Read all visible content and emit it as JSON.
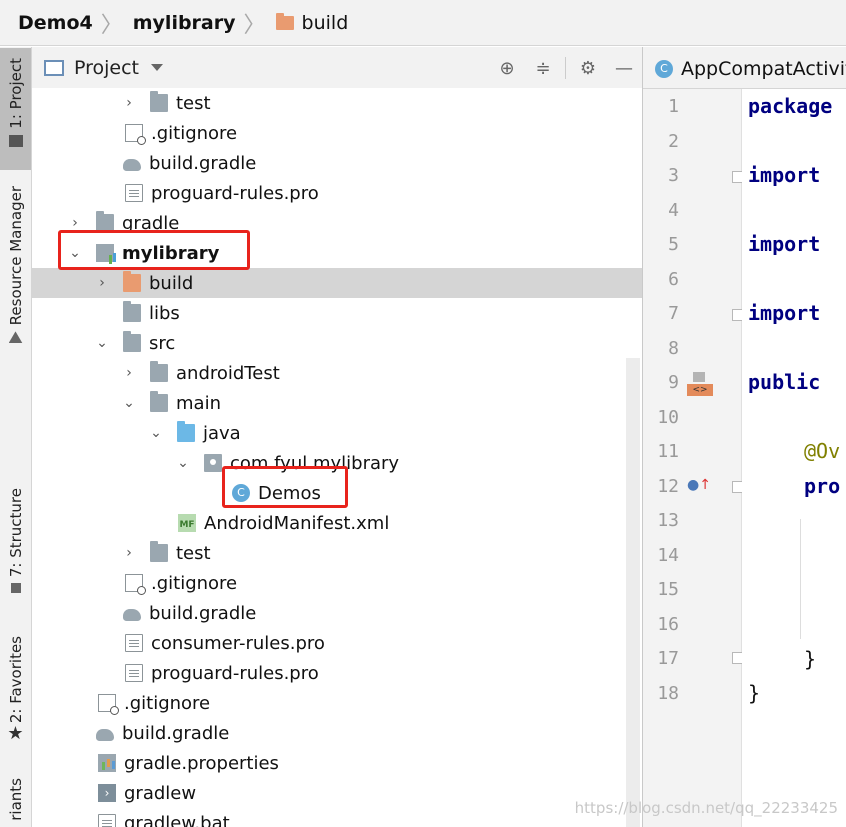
{
  "breadcrumb": [
    "Demo4",
    "mylibrary",
    "build"
  ],
  "left_strip": {
    "project_tab": "1: Project",
    "resource_manager_tab": "Resource Manager",
    "structure_tab": "7: Structure",
    "favorites_tab": "2: Favorites",
    "variants_tab": "riants"
  },
  "project_panel": {
    "title": "Project"
  },
  "tree": [
    {
      "label": "test"
    },
    {
      "label": ".gitignore"
    },
    {
      "label": "build.gradle"
    },
    {
      "label": "proguard-rules.pro"
    },
    {
      "label": "gradle"
    },
    {
      "label": "mylibrary"
    },
    {
      "label": "build"
    },
    {
      "label": "libs"
    },
    {
      "label": "src"
    },
    {
      "label": "androidTest"
    },
    {
      "label": "main"
    },
    {
      "label": "java"
    },
    {
      "label": "com.fyul.mylibrary"
    },
    {
      "label": "Demos"
    },
    {
      "label": "AndroidManifest.xml"
    },
    {
      "label": "test"
    },
    {
      "label": ".gitignore"
    },
    {
      "label": "build.gradle"
    },
    {
      "label": "consumer-rules.pro"
    },
    {
      "label": "proguard-rules.pro"
    },
    {
      "label": ".gitignore"
    },
    {
      "label": "build.gradle"
    },
    {
      "label": "gradle.properties"
    },
    {
      "label": "gradlew"
    },
    {
      "label": "gradlew.bat"
    }
  ],
  "editor": {
    "tab_label": "AppCompatActivit",
    "line_numbers": [
      "1",
      "2",
      "3",
      "4",
      "5",
      "6",
      "7",
      "8",
      "9",
      "10",
      "11",
      "12",
      "13",
      "14",
      "15",
      "16",
      "17",
      "18"
    ],
    "code": {
      "l1": "package",
      "l3": "import",
      "l5": "import",
      "l7": "import",
      "l9": "public",
      "l11": "@Ov",
      "l12": "pro",
      "l17": "}",
      "l18": "}"
    }
  },
  "watermark": "https://blog.csdn.net/qq_22233425",
  "colors": {
    "highlight": "#e8231c",
    "selection": "#d5d5d5",
    "keyword": "#000080"
  }
}
